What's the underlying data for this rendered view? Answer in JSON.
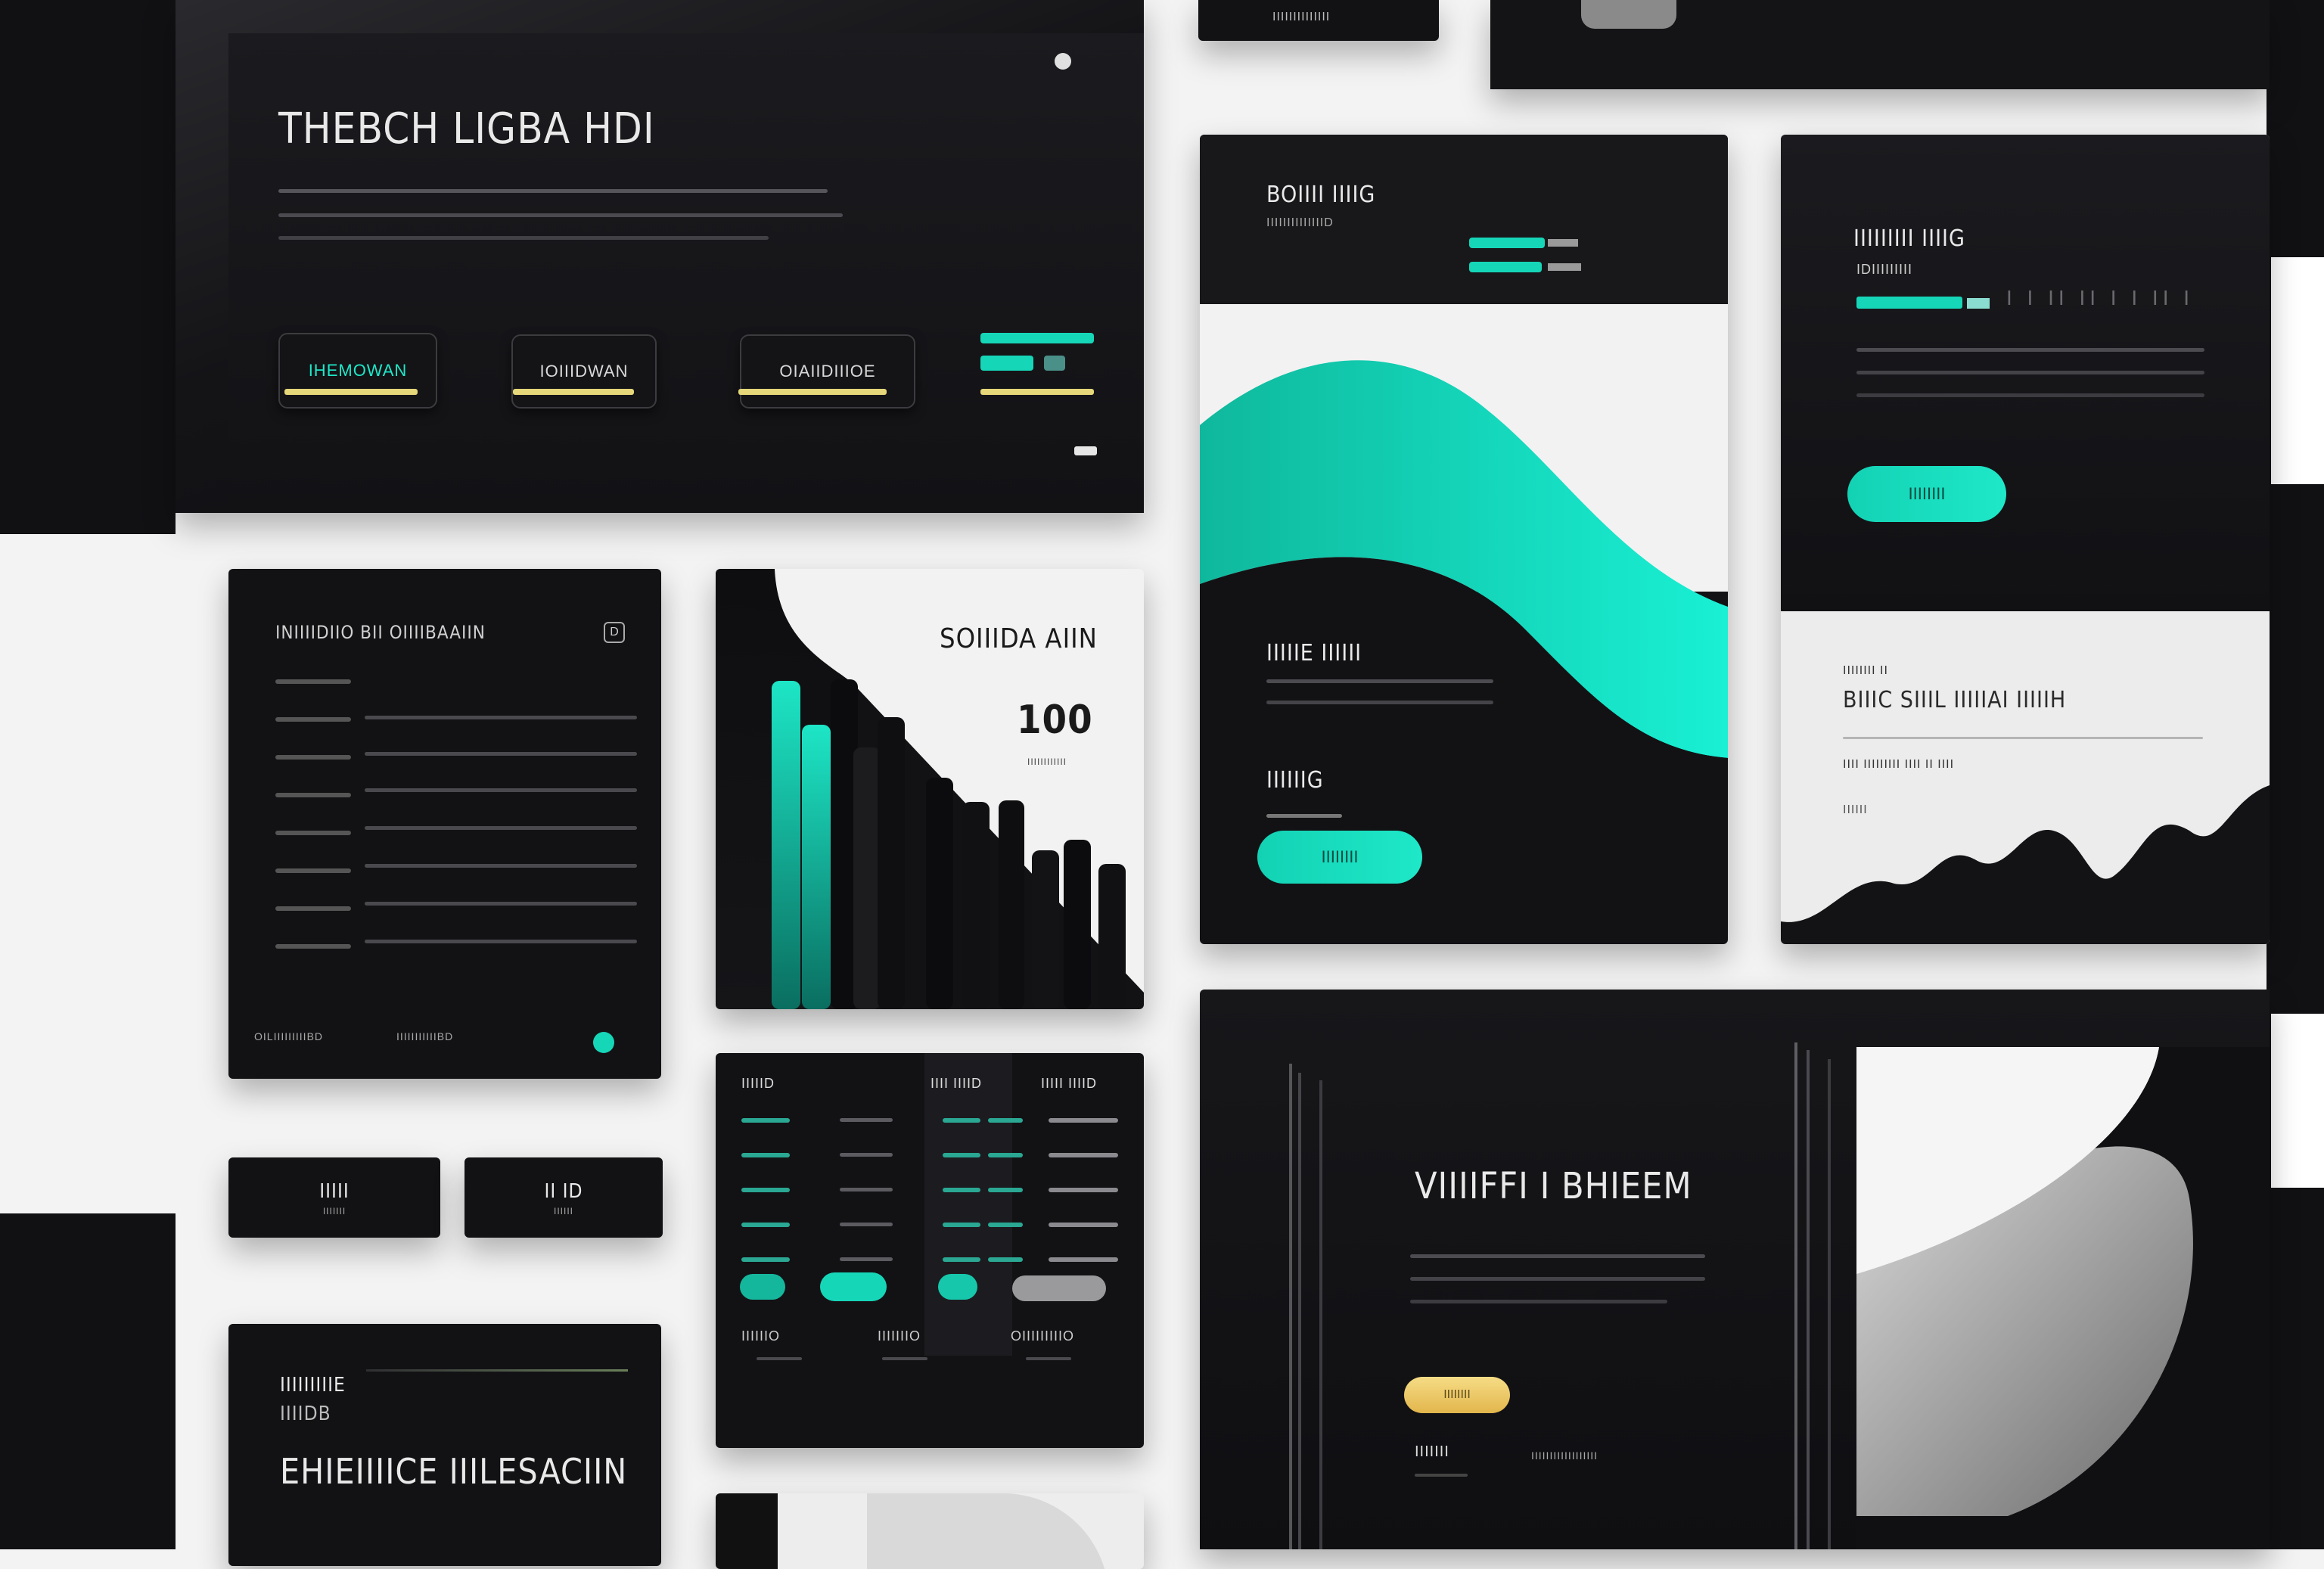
{
  "hero": {
    "title": "THEBCH LIGBA HDI",
    "buttons": [
      "IHEMOWAN",
      "IOIIIDWAN",
      "OIAIIDIIIOE"
    ]
  },
  "list_card": {
    "title": "INIIIIDIIO BII OIIIIBAAIIN",
    "footer_left": "OILIIIIIIIIIBD",
    "footer_right": "IIIIIIIIIIIBD"
  },
  "stat_tiles": [
    {
      "value": "IIIII",
      "label": "IIIIIII"
    },
    {
      "value": "II ID",
      "label": "IIIIII"
    }
  ],
  "bottom_card": {
    "line1": "IIIIIIIIIE",
    "line2": "IIIIDB",
    "title": "EHIEIIIICE IIILESACIIN"
  },
  "bar_card": {
    "title": "SOIIIDA AIIN",
    "value": "100",
    "caption": "IIIIIIIIIIII"
  },
  "table_card": {
    "headers": [
      "IIIIID",
      "IIII IIIID",
      "IIIII IIIID"
    ],
    "footer": [
      "IIIIIIO",
      "IIIIIIIO",
      "OIIIIIIIIIO"
    ]
  },
  "wave_card": {
    "header_title": "BOIIII IIIIG",
    "header_sub": "IIIIIIIIIIIIIID",
    "section_title": "IIIIIE IIIIII",
    "label": "IIIIIIG",
    "button": "IIIIIIII"
  },
  "right_card": {
    "title": "IIIIIIIII IIIIG",
    "subtitle": "IDIIIIIIIII",
    "readout": "I I II II I I II I",
    "button": "IIIIIIII",
    "small": "IIIIIIII II",
    "heading": "BIIIC SIIIL IIIIIAI IIIIIH",
    "caption": "IIII IIIIIIIII IIII II IIII",
    "tag": "IIIIII"
  },
  "hero2": {
    "title": "VIIIIFFI I BHIEEM",
    "button": "IIIIIIII",
    "left_label": "IIIIIII",
    "right_label": "IIIIIIIIIIIIIIIIII"
  },
  "top_strip": {
    "label": "IIIIIIIIIIIIII"
  },
  "colors": {
    "accent": "#16d6b8",
    "yellow": "#e6d77a",
    "dark": "#121215"
  }
}
